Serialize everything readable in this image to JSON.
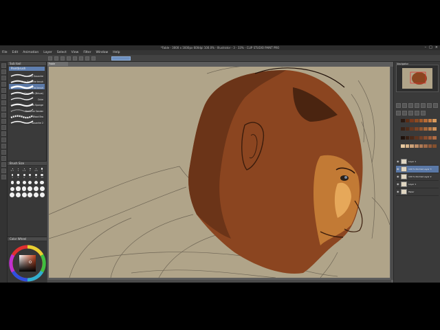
{
  "app": {
    "title": "*Fable - 3000 x 1600px 600dpi 100.0%   - Illustrator - 3 - 33% - CLIP STUDIO PAINT PRO"
  },
  "window_controls": [
    "–",
    "□",
    "×"
  ],
  "menu": [
    "File",
    "Edit",
    "Animation",
    "Layer",
    "Select",
    "View",
    "Filter",
    "Window",
    "Help"
  ],
  "document_tab": "Fable",
  "subtool": {
    "panel_title": "Sub tool",
    "group_tab": "Paintbrush",
    "brushes": [
      {
        "name": "Dry Gouache",
        "selected": false
      },
      {
        "name": "Thin Gouache brush",
        "selected": false
      },
      {
        "name": "Flat brush",
        "selected": true
      },
      {
        "name": "Gouache (Brisue)",
        "selected": false
      },
      {
        "name": "Ocke",
        "selected": false
      },
      {
        "name": "Oils Sponge",
        "selected": false
      },
      {
        "name": "Gouache Sander",
        "selected": false
      },
      {
        "name": "Wood Bra",
        "selected": false
      },
      {
        "name": "Gouache 2",
        "selected": false
      }
    ]
  },
  "brush_size": {
    "panel_title": "Brush Size",
    "sizes": [
      "0.7",
      "1",
      "1.5",
      "2",
      "2.5",
      "3",
      "4",
      "5",
      "6",
      "7",
      "8",
      "10",
      "12",
      "15",
      "17",
      "20",
      "25",
      "30",
      "40",
      "50",
      "60",
      "70",
      "80",
      "100",
      "120",
      "150",
      "170",
      "200",
      "250",
      "300"
    ]
  },
  "color": {
    "panel_title": "Color Wheel",
    "current": "#7a3b1f"
  },
  "navigator": {
    "title": "Navigator"
  },
  "palette": [
    "#2a1a12",
    "#5a2d16",
    "#7a3b1f",
    "#8c4a22",
    "#a35a2a",
    "#b56b36",
    "#c97e44",
    "#d99a5c",
    "#3a2216",
    "#4e2a18",
    "#6a3820",
    "#7f4526",
    "#94552e",
    "#a8683a",
    "#bb7a46",
    "#cf9158",
    "#1e120c",
    "#351e12",
    "#4a2818",
    "#5e331e",
    "#733f26",
    "#874c2e",
    "#9b5a38",
    "#b06c44",
    "#e6c8a0",
    "#d8b48a",
    "#caa078",
    "#bc8c66",
    "#ae7a56",
    "#a06a48",
    "#925a3a",
    "#84502e"
  ],
  "layers": [
    {
      "name": "Layer 1",
      "active": false
    },
    {
      "name": "100 % Normal Layer 3",
      "active": true
    },
    {
      "name": "100 % Normal Layer 2",
      "active": false
    },
    {
      "name": "Layer 1",
      "active": false
    },
    {
      "name": "Paper",
      "active": false
    }
  ],
  "canvas": {
    "background": "#b0a489",
    "skin_shadow": "#6b3418",
    "skin_mid": "#8b4520",
    "skin_light": "#c27a35",
    "highlight": "#e6a85a"
  }
}
